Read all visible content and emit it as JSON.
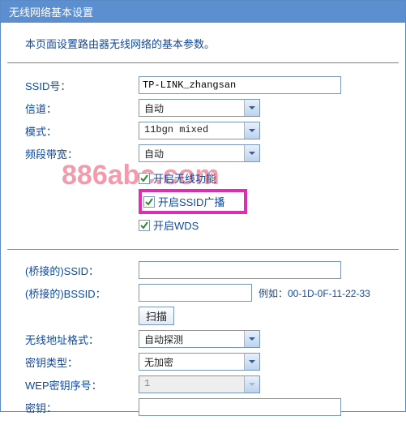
{
  "header": {
    "title": "无线网络基本设置"
  },
  "intro": "本页面设置路由器无线网络的基本参数。",
  "watermark": "886abc.com",
  "labels": {
    "ssid": "SSID号：",
    "channel": "信道：",
    "mode": "模式：",
    "bandwidth": "频段带宽：",
    "bridged_ssid": "(桥接的)SSID：",
    "bridged_bssid": "(桥接的)BSSID：",
    "addr_format": "无线地址格式：",
    "key_type": "密钥类型：",
    "wep_index": "WEP密钥序号：",
    "key": "密钥："
  },
  "values": {
    "ssid": "TP-LINK_zhangsan",
    "channel": "自动",
    "mode": "11bgn mixed",
    "bandwidth": "自动",
    "bridged_ssid": "",
    "bridged_bssid": "",
    "addr_format": "自动探测",
    "key_type": "无加密",
    "wep_index": "1",
    "key": ""
  },
  "checks": {
    "enable_wireless": "开启无线功能",
    "enable_ssid_bc": "开启SSID广播",
    "enable_wds": "开启WDS"
  },
  "example_label": "例如：00-1D-0F-11-22-33",
  "scan_btn": "扫描",
  "colors": {
    "accent": "#5b8fcf",
    "text": "#12489e",
    "highlight": "#e22bb3",
    "watermark": "#f08a9e"
  }
}
